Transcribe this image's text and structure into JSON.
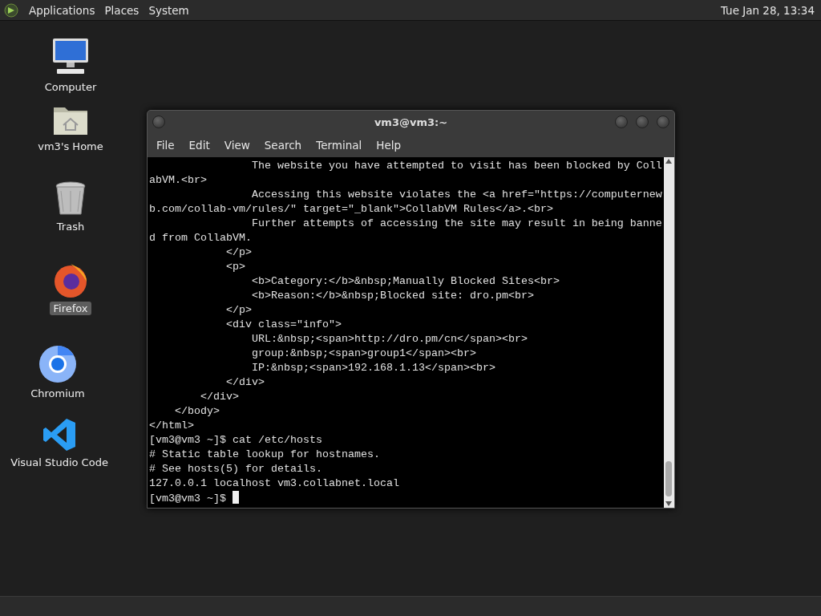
{
  "top_panel": {
    "menus": [
      "Applications",
      "Places",
      "System"
    ],
    "clock": "Tue Jan 28, 13:34"
  },
  "desktop_icons": [
    {
      "kind": "computer",
      "label": "Computer",
      "selected": false
    },
    {
      "kind": "home",
      "label": "vm3's Home",
      "selected": false
    },
    {
      "kind": "trash",
      "label": "Trash",
      "selected": false
    },
    {
      "kind": "firefox",
      "label": "Firefox",
      "selected": true
    },
    {
      "kind": "chromium",
      "label": "Chromium",
      "selected": false
    },
    {
      "kind": "vscode",
      "label": "Visual Studio Code",
      "selected": false
    }
  ],
  "window": {
    "title": "vm3@vm3:~",
    "menu": [
      "File",
      "Edit",
      "View",
      "Search",
      "Terminal",
      "Help"
    ],
    "terminal_lines": [
      "                The website you have attempted to visit has been blocked by Coll",
      "abVM.<br>",
      "                Accessing this website violates the <a href=\"https://computernew",
      "b.com/collab-vm/rules/\" target=\"_blank\">CollabVM Rules</a>.<br>",
      "                Further attempts of accessing the site may result in being banne",
      "d from CollabVM.",
      "            </p>",
      "            <p>",
      "                <b>Category:</b>&nbsp;Manually Blocked Sites<br>",
      "                <b>Reason:</b>&nbsp;Blocked site: dro.pm<br>",
      "            </p>",
      "            <div class=\"info\">",
      "                URL:&nbsp;<span>http://dro.pm/cn</span><br>",
      "                group:&nbsp;<span>group1</span><br>",
      "                IP:&nbsp;<span>192.168.1.13</span><br>",
      "            </div>",
      "        </div>",
      "    </body>",
      "</html>",
      "[vm3@vm3 ~]$ cat /etc/hosts",
      "# Static table lookup for hostnames.",
      "# See hosts(5) for details.",
      "127.0.0.1 localhost vm3.collabnet.local"
    ],
    "prompt": "[vm3@vm3 ~]$ "
  }
}
